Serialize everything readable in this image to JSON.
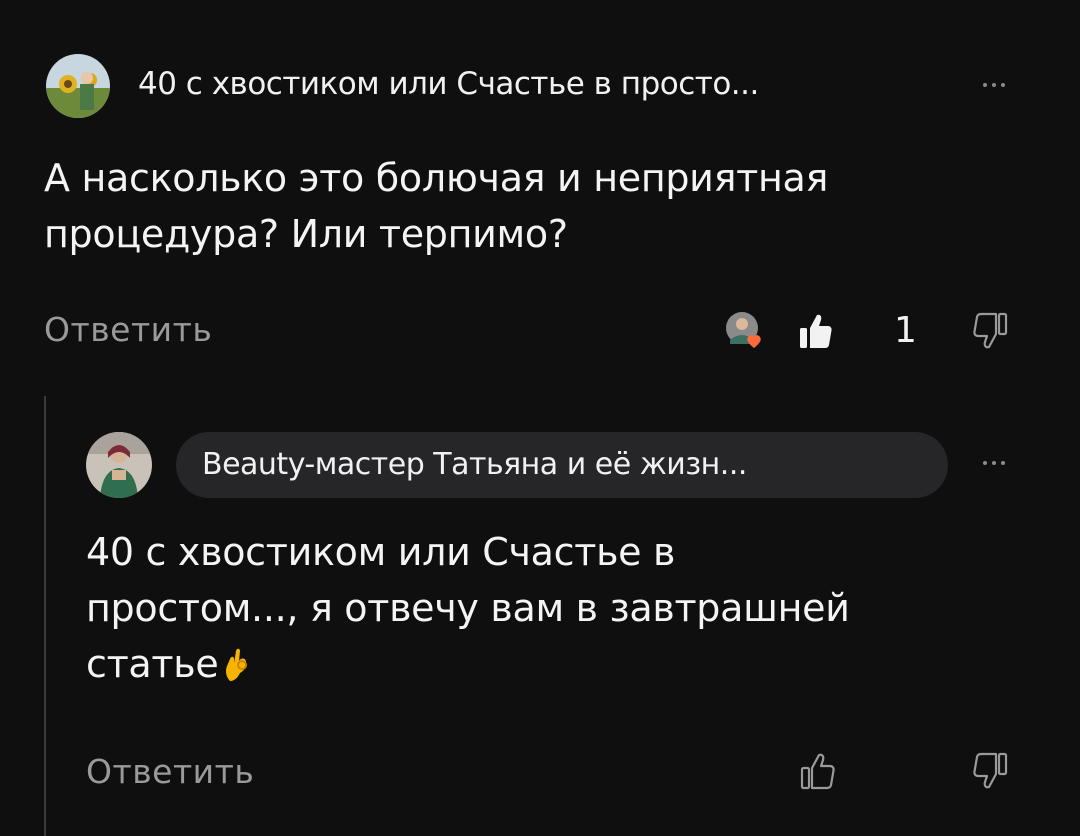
{
  "comment": {
    "author": "40 с хвостиком или Счастье в просто...",
    "text_line1": "А насколько это болючая и неприятная",
    "text_line2": "процедура? Или терпимо?",
    "reply_label": "Ответить",
    "like_count": "1",
    "icons": {
      "like": "thumbs-up-filled-icon",
      "dislike": "thumbs-down-outline-icon",
      "more": "more-dots-icon",
      "liker_avatar": "author-heart-avatar"
    }
  },
  "reply": {
    "author": "Beauty-мастер Татьяна и её жизн...",
    "text_line1": "40 с хвостиком или Счастье в",
    "text_line2": "простом..., я отвечу вам в завтрашней",
    "text_line3": "статье",
    "emoji": "👌",
    "reply_label": "Ответить",
    "icons": {
      "like": "thumbs-up-outline-icon",
      "dislike": "thumbs-down-outline-icon",
      "more": "more-dots-icon"
    }
  },
  "colors": {
    "background": "#0f0f10",
    "text": "#f2f2f2",
    "muted": "#9a9a9a",
    "pill": "#262628",
    "heart": "#ff6a3d"
  }
}
